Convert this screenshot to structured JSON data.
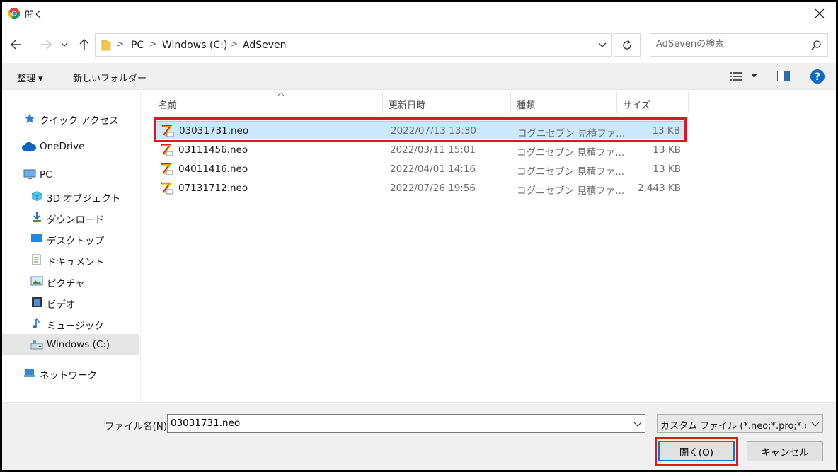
{
  "window": {
    "title": "開く",
    "accent": "#0078d7",
    "highlight": "#e3141f"
  },
  "breadcrumb": [
    "PC",
    "Windows (C:)",
    "AdSeven"
  ],
  "search": {
    "placeholder": "AdSevenの検索"
  },
  "toolbar": {
    "organize": "整理 ▾",
    "new_folder": "新しいフォルダー"
  },
  "sidebar": {
    "items": [
      {
        "label": "クイック アクセス",
        "icon": "star-icon"
      },
      {
        "label": "OneDrive",
        "icon": "cloud-icon"
      },
      {
        "label": "PC",
        "icon": "computer-icon"
      },
      {
        "label": "3D オブジェクト",
        "icon": "cube-icon"
      },
      {
        "label": "ダウンロード",
        "icon": "download-icon"
      },
      {
        "label": "デスクトップ",
        "icon": "desktop-icon"
      },
      {
        "label": "ドキュメント",
        "icon": "document-icon"
      },
      {
        "label": "ピクチャ",
        "icon": "picture-icon"
      },
      {
        "label": "ビデオ",
        "icon": "video-icon"
      },
      {
        "label": "ミュージック",
        "icon": "music-icon"
      },
      {
        "label": "Windows (C:)",
        "icon": "drive-icon",
        "selected": true
      },
      {
        "label": "ネットワーク",
        "icon": "network-icon"
      }
    ]
  },
  "columns": {
    "name": "名前",
    "date": "更新日時",
    "type": "種類",
    "size": "サイズ"
  },
  "files": [
    {
      "name": "03031731.neo",
      "date": "2022/07/13 13:30",
      "type": "コグニセブン 見積ファ...",
      "size": "13 KB",
      "selected": true
    },
    {
      "name": "03111456.neo",
      "date": "2022/03/11 15:01",
      "type": "コグニセブン 見積ファ...",
      "size": "13 KB"
    },
    {
      "name": "04011416.neo",
      "date": "2022/04/01 14:16",
      "type": "コグニセブン 見積ファ...",
      "size": "13 KB"
    },
    {
      "name": "07131712.neo",
      "date": "2022/07/26 19:56",
      "type": "コグニセブン 見積ファ...",
      "size": "2,443 KB"
    }
  ],
  "footer": {
    "filename_label": "ファイル名(N):",
    "filename_value": "03031731.neo",
    "filter_value": "カスタム ファイル (*.neo;*.pro;*.csv;*",
    "open_button": "開く(O)",
    "cancel_button": "キャンセル"
  }
}
